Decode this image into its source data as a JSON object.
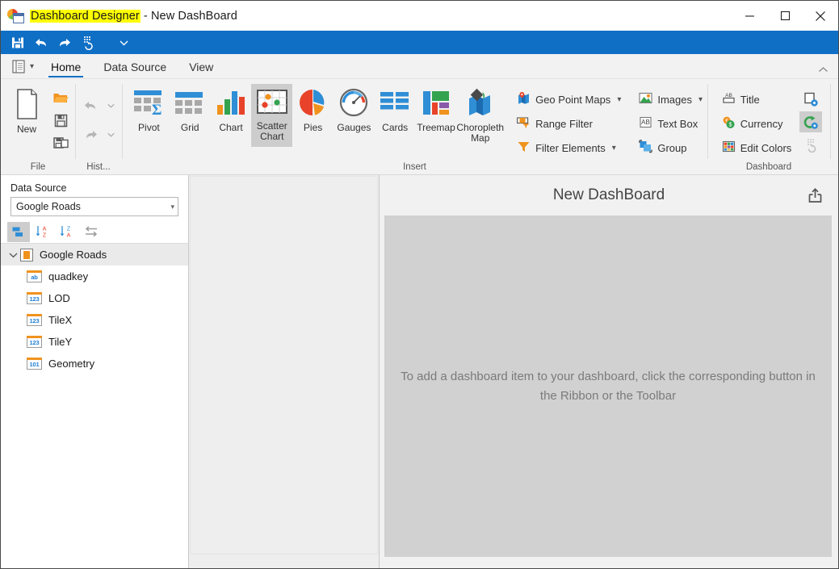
{
  "window": {
    "title_highlight": "Dashboard Designer",
    "title_rest": " - New DashBoard",
    "app_icon": "dashboard-designer-icon",
    "minimize": "—",
    "maximize": "□",
    "close": "✕"
  },
  "quick_access": {
    "items": [
      {
        "name": "save-icon",
        "label": "Save"
      },
      {
        "name": "undo-icon",
        "label": "Undo"
      },
      {
        "name": "redo-icon",
        "label": "Redo"
      },
      {
        "name": "refresh-data-icon",
        "label": "Update Data Source"
      },
      {
        "name": "customize-quick-access-icon",
        "label": "Customize Quick Access Toolbar"
      }
    ]
  },
  "ribbon": {
    "file_menu_icon": "file-menu-icon",
    "collapse_icon": "chevron-up-icon",
    "tabs": [
      {
        "label": "Home",
        "active": true
      },
      {
        "label": "Data Source",
        "active": false
      },
      {
        "label": "View",
        "active": false
      }
    ],
    "groups": {
      "file": {
        "label": "File",
        "new_label": "New",
        "buttons": [
          {
            "name": "open-icon",
            "label": "Open"
          },
          {
            "name": "save-icon",
            "label": "Save"
          },
          {
            "name": "save-as-icon",
            "label": "Save As"
          }
        ]
      },
      "history": {
        "label": "Hist...",
        "buttons": [
          {
            "name": "undo-icon",
            "label": "Undo"
          },
          {
            "name": "undo-dropdown-icon",
            "label": "Undo History"
          },
          {
            "name": "redo-icon",
            "label": "Redo"
          },
          {
            "name": "redo-dropdown-icon",
            "label": "Redo History"
          }
        ]
      },
      "insert": {
        "label": "Insert",
        "items": [
          {
            "label": "Pivot",
            "icon": "pivot-icon",
            "selected": false
          },
          {
            "label": "Grid",
            "icon": "grid-icon",
            "selected": false
          },
          {
            "label": "Chart",
            "icon": "chart-icon",
            "selected": false
          },
          {
            "label": "Scatter Chart",
            "icon": "scatter-chart-icon",
            "selected": true
          },
          {
            "label": "Pies",
            "icon": "pies-icon",
            "selected": false
          },
          {
            "label": "Gauges",
            "icon": "gauges-icon",
            "selected": false
          },
          {
            "label": "Cards",
            "icon": "cards-icon",
            "selected": false
          },
          {
            "label": "Treemap",
            "icon": "treemap-icon",
            "selected": false
          },
          {
            "label": "Choropleth Map",
            "icon": "choropleth-map-icon",
            "selected": false
          }
        ],
        "menu_col_1": [
          {
            "label": "Geo Point Maps",
            "icon": "geo-point-maps-icon",
            "dropdown": true
          },
          {
            "label": "Range Filter",
            "icon": "range-filter-icon",
            "dropdown": false
          },
          {
            "label": "Filter Elements",
            "icon": "filter-elements-icon",
            "dropdown": true
          }
        ],
        "menu_col_2": [
          {
            "label": "Images",
            "icon": "images-icon",
            "dropdown": true
          },
          {
            "label": "Text Box",
            "icon": "text-box-icon",
            "dropdown": false
          },
          {
            "label": "Group",
            "icon": "group-icon",
            "dropdown": false
          }
        ]
      },
      "dashboard": {
        "label": "Dashboard",
        "items": [
          {
            "label": "Title",
            "icon": "title-icon"
          },
          {
            "label": "Currency",
            "icon": "currency-icon"
          },
          {
            "label": "Edit Colors",
            "icon": "edit-colors-icon"
          }
        ],
        "side_buttons": [
          {
            "name": "dashboard-settings-icon",
            "selected": false,
            "enabled": true
          },
          {
            "name": "auto-refresh-settings-icon",
            "selected": true,
            "enabled": true
          },
          {
            "name": "update-data-source-icon",
            "selected": false,
            "enabled": false
          }
        ]
      }
    }
  },
  "left_panel": {
    "data_source_label": "Data Source",
    "data_source_value": "Google Roads",
    "dropdown_icon": "chevron-down-icon",
    "toolbar": [
      {
        "name": "group-fields-icon",
        "selected": true
      },
      {
        "name": "sort-ascending-icon",
        "selected": false,
        "glyph_top": "A",
        "glyph_bottom": "Z"
      },
      {
        "name": "sort-descending-icon",
        "selected": false,
        "glyph_top": "Z",
        "glyph_bottom": "A"
      },
      {
        "name": "toggle-field-list-icon",
        "selected": false
      }
    ],
    "tree": {
      "root": {
        "label": "Google Roads",
        "icon": "data-source-root-icon",
        "expanded": true
      },
      "fields": [
        {
          "label": "quadkey",
          "type": "ab",
          "icon": "string-field-icon"
        },
        {
          "label": "LOD",
          "type": "123",
          "icon": "number-field-icon"
        },
        {
          "label": "TileX",
          "type": "123",
          "icon": "number-field-icon"
        },
        {
          "label": "TileY",
          "type": "123",
          "icon": "number-field-icon"
        },
        {
          "label": "Geometry",
          "type": "101",
          "icon": "binary-field-icon"
        }
      ]
    }
  },
  "canvas": {
    "title": "New DashBoard",
    "export_icon": "export-icon",
    "hint": "To add a dashboard item to your dashboard, click the corresponding button in the Ribbon or the Toolbar"
  },
  "colors": {
    "accent_blue": "#0f6fc5",
    "highlight_yellow": "#ffff00",
    "ribbon_bg": "#f2f2f2",
    "canvas_gray": "#d1d1d1",
    "selected_gray": "#cdcdcd",
    "orange": "#f0921e"
  }
}
